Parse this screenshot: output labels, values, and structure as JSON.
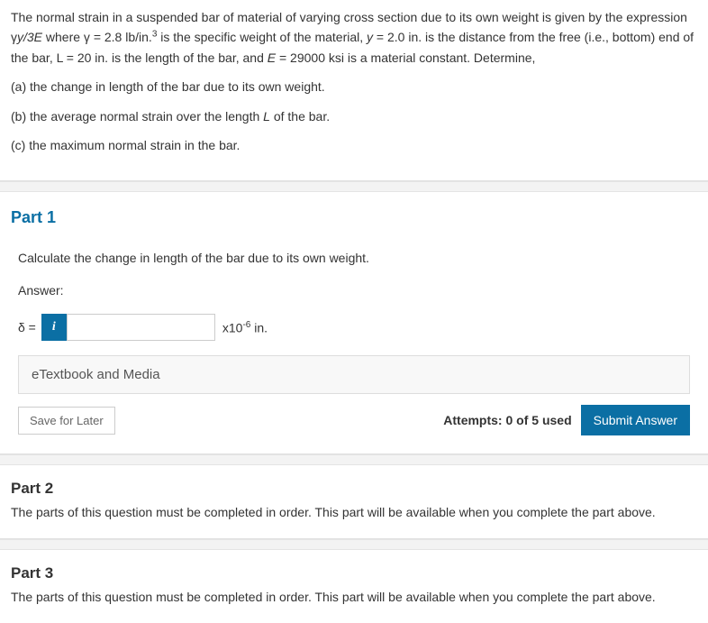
{
  "problem": {
    "intro": "The normal strain in a suspended bar of material of varying cross section due to its own weight is given by the expression γy/3E where γ = 2.8 lb/in.³ is the specific weight of the material, y = 2.0 in. is the distance from the free (i.e., bottom) end of the bar, L = 20 in. is the length of the bar, and E = 29000 ksi is a material constant. Determine,",
    "a": "(a) the change in length of the bar due to its own weight.",
    "b": "(b) the average normal strain over the length L of the bar.",
    "c": "(c) the maximum normal strain in the bar."
  },
  "part1": {
    "title": "Part 1",
    "instruction": "Calculate the change in length of the bar due to its own weight.",
    "answer_label": "Answer:",
    "delta_eq": "δ =",
    "info_icon": "i",
    "input_value": "",
    "unit_prefix": "x10",
    "unit_exp": "-6",
    "unit_suffix": " in.",
    "etextbook": "eTextbook and Media",
    "save": "Save for Later",
    "attempts": "Attempts: 0 of 5 used",
    "submit": "Submit Answer"
  },
  "part2": {
    "title": "Part 2",
    "message": "The parts of this question must be completed in order. This part will be available when you complete the part above."
  },
  "part3": {
    "title": "Part 3",
    "message": "The parts of this question must be completed in order. This part will be available when you complete the part above."
  }
}
